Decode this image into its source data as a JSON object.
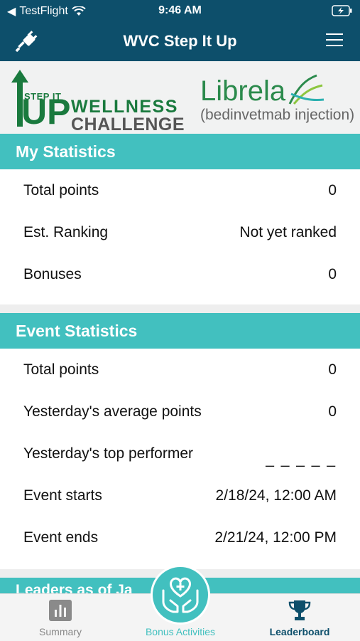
{
  "statusbar": {
    "carrier": "TestFlight",
    "time": "9:46 AM"
  },
  "navbar": {
    "title": "WVC Step It Up"
  },
  "banner": {
    "logo_step": "STEP IT",
    "logo_up": "UP",
    "logo_wellness": "WELLNESS",
    "logo_challenge": "CHALLENGE",
    "librela": "Librela",
    "librela_sub": "(bedinvetmab injection)"
  },
  "my_stats": {
    "title": "My Statistics",
    "rows": [
      {
        "label": "Total points",
        "value": "0"
      },
      {
        "label": "Est. Ranking",
        "value": "Not yet ranked"
      },
      {
        "label": "Bonuses",
        "value": "0"
      }
    ]
  },
  "event_stats": {
    "title": "Event Statistics",
    "rows": [
      {
        "label": "Total points",
        "value": "0"
      },
      {
        "label": "Yesterday's average points",
        "value": "0"
      },
      {
        "label": "Yesterday's top performer",
        "value": "_ _ _ _ _"
      },
      {
        "label": "Event starts",
        "value": "2/18/24, 12:00 AM"
      },
      {
        "label": "Event ends",
        "value": "2/21/24, 12:00 PM"
      }
    ]
  },
  "leaders_partial": "Leaders as of Ja",
  "tabs": {
    "summary": "Summary",
    "bonus": "Bonus Activities",
    "leaderboard": "Leaderboard"
  },
  "colors": {
    "navy": "#0d4f6b",
    "teal": "#42c0bf",
    "green": "#1a7a3e"
  }
}
